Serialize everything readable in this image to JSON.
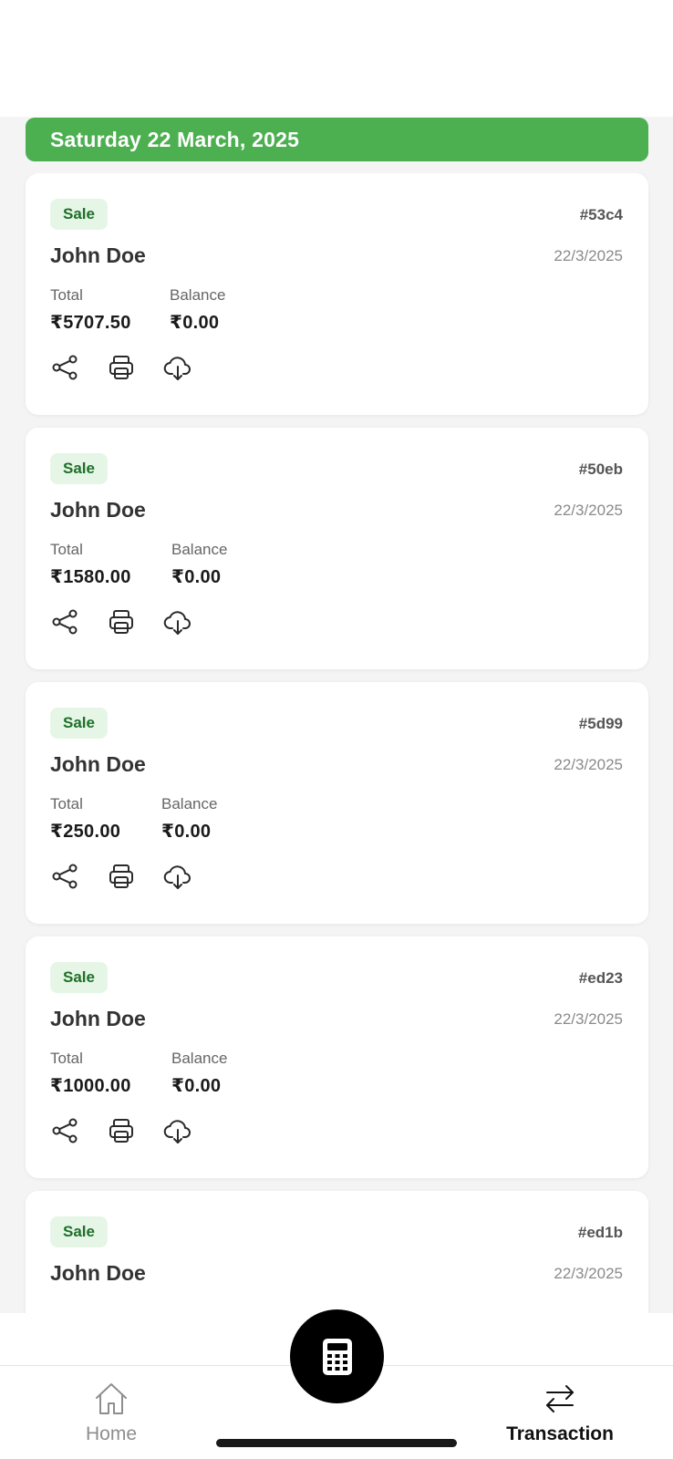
{
  "header": {
    "date_label": "Saturday 22 March, 2025"
  },
  "labels": {
    "total": "Total",
    "balance": "Balance"
  },
  "transactions": [
    {
      "type": "Sale",
      "id": "#53c4",
      "customer": "John Doe",
      "date": "22/3/2025",
      "total": "₹5707.50",
      "balance": "₹0.00"
    },
    {
      "type": "Sale",
      "id": "#50eb",
      "customer": "John Doe",
      "date": "22/3/2025",
      "total": "₹1580.00",
      "balance": "₹0.00"
    },
    {
      "type": "Sale",
      "id": "#5d99",
      "customer": "John Doe",
      "date": "22/3/2025",
      "total": "₹250.00",
      "balance": "₹0.00"
    },
    {
      "type": "Sale",
      "id": "#ed23",
      "customer": "John Doe",
      "date": "22/3/2025",
      "total": "₹1000.00",
      "balance": "₹0.00"
    },
    {
      "type": "Sale",
      "id": "#ed1b",
      "customer": "John Doe",
      "date": "22/3/2025",
      "total": "",
      "balance": ""
    }
  ],
  "actions": {
    "icons": [
      "share-icon",
      "print-icon",
      "cloud-download-icon"
    ]
  },
  "bottom_nav": {
    "home_label": "Home",
    "transaction_label": "Transaction",
    "fab_icon": "calculator-icon",
    "active": "Transaction"
  },
  "colors": {
    "accent_green": "#4caf50",
    "badge_bg": "#e6f6e6",
    "badge_text": "#1f6f2a",
    "fab_bg": "#000000"
  }
}
